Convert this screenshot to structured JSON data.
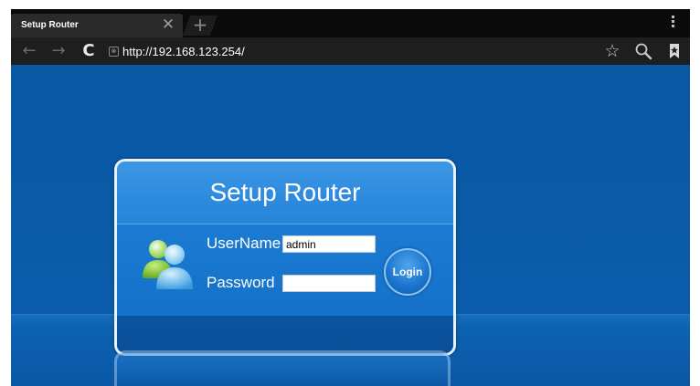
{
  "browser": {
    "tab": {
      "title": "Setup Router",
      "close_glyph": "✕",
      "new_tab_glyph": "+"
    },
    "toolbar": {
      "back_glyph": "←",
      "forward_glyph": "→",
      "reload_glyph": "C",
      "url": "http://192.168.123.254/",
      "star_glyph": "☆"
    },
    "icons": [
      "close-icon",
      "plus-icon",
      "menu-dots-icon",
      "back-arrow-icon",
      "forward-arrow-icon",
      "reload-icon",
      "site-info-icon",
      "star-icon",
      "search-icon",
      "bookmarks-icon"
    ]
  },
  "login_panel": {
    "title": "Setup Router",
    "username_label": "UserName",
    "username_value": "admin",
    "password_label": "Password",
    "password_value": "",
    "login_label": "Login"
  },
  "colors": {
    "page_background": "#0a57a4",
    "panel_header": "#2d8ade",
    "panel_border": "#e8f1fb"
  }
}
